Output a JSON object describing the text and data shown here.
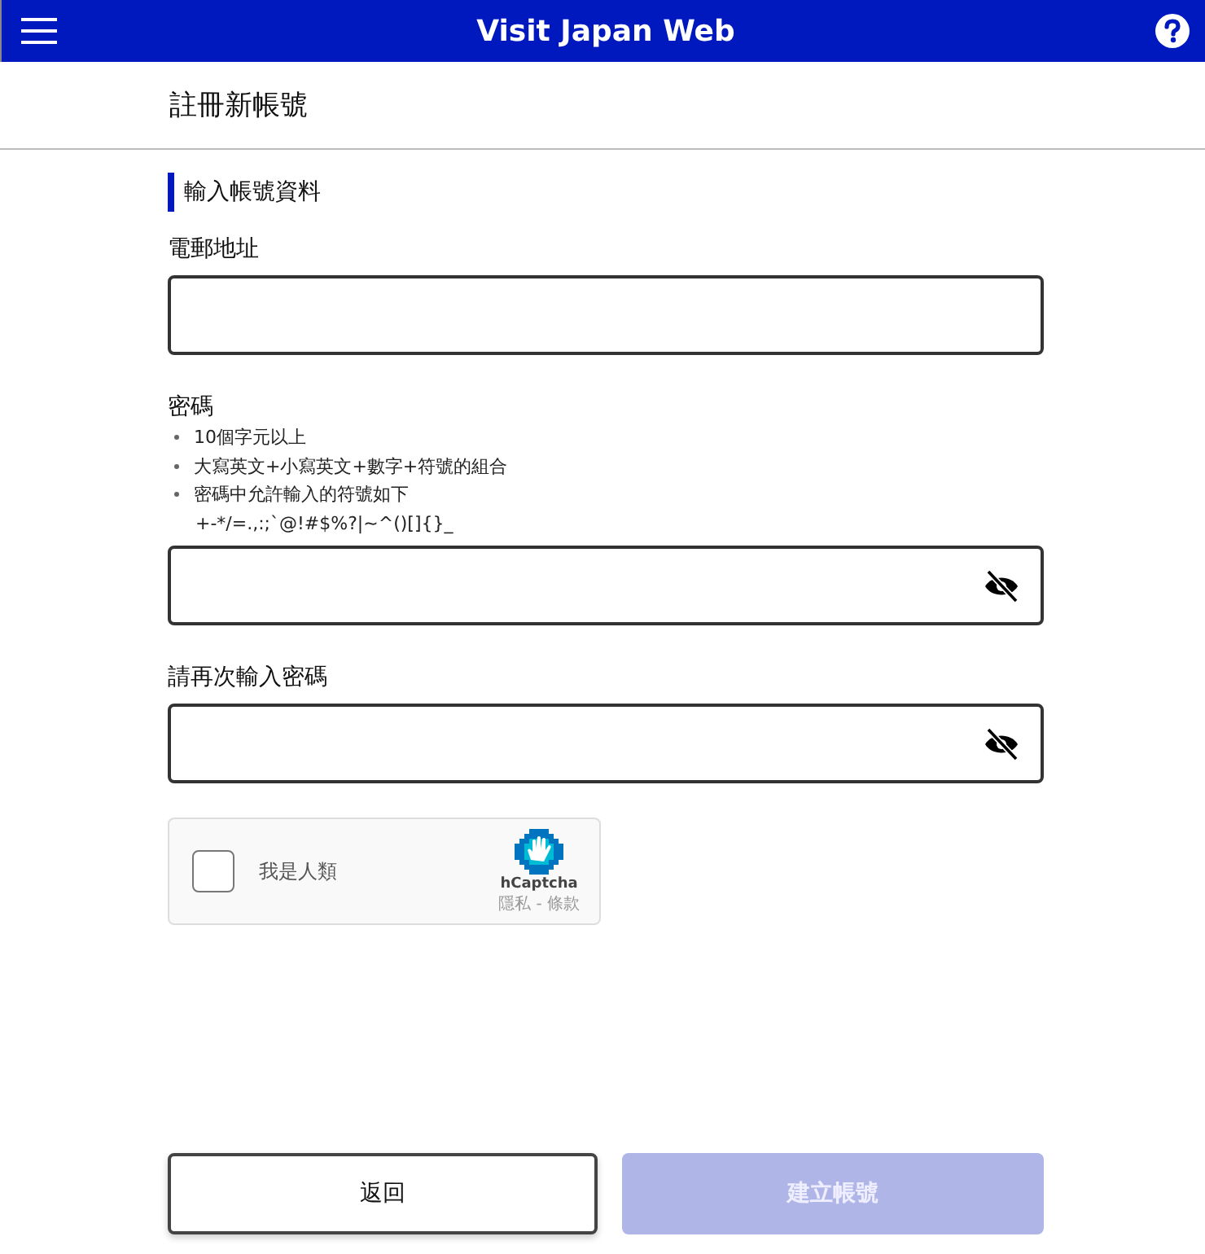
{
  "header": {
    "title": "Visit Japan Web"
  },
  "page_title": "註冊新帳號",
  "section_title": "輸入帳號資料",
  "fields": [
    {
      "kind": "text",
      "label": "電郵地址"
    },
    {
      "kind": "password",
      "label": "密碼",
      "hints": [
        "10個字元以上",
        "大寫英文+小寫英文+數字+符號的組合",
        "密碼中允許輸入的符號如下"
      ],
      "symbols": "+-*/=.,:;`@!#$%?|~^()[]{}_",
      "visible": false
    },
    {
      "kind": "password",
      "label": "請再次輸入密碼",
      "visible": false
    }
  ],
  "captcha": {
    "label": "我是人類",
    "checked": false,
    "brand": "hCaptcha",
    "links": "隱私 - 條款"
  },
  "buttons": [
    {
      "label": "返回",
      "kind": "secondary",
      "disabled": false
    },
    {
      "label": "建立帳號",
      "kind": "primary",
      "disabled": true
    }
  ]
}
